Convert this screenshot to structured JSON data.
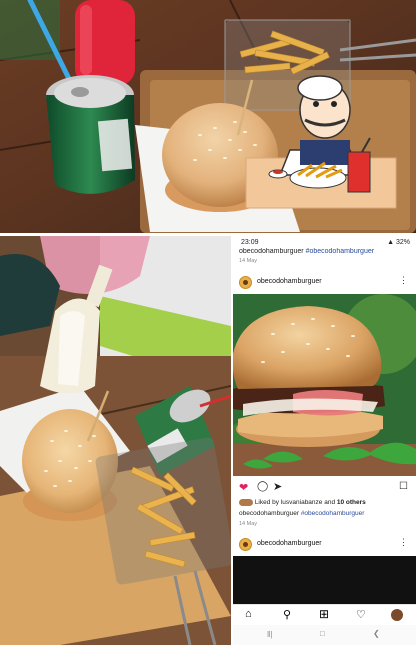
{
  "phone": {
    "status_time": "23:09",
    "status_battery": "32%",
    "prev_caption_user": "obecodohamburguer",
    "prev_caption_tag": "#obecodohamburguer",
    "prev_date": "14 May",
    "post_username": "obecodohamburguer",
    "liked_by_prefix": "Liked by",
    "liked_by_user": "lusvaniabanze",
    "liked_by_and": "and",
    "liked_by_others": "10 others",
    "caption_user": "obecodohamburguer",
    "caption_tag": "#obecodohamburguer",
    "post_date": "14 May",
    "next_username": "obecodohamburguer"
  },
  "icons": {
    "heart_color": "#e0245e",
    "accent_blue": "#2a4a9a"
  }
}
